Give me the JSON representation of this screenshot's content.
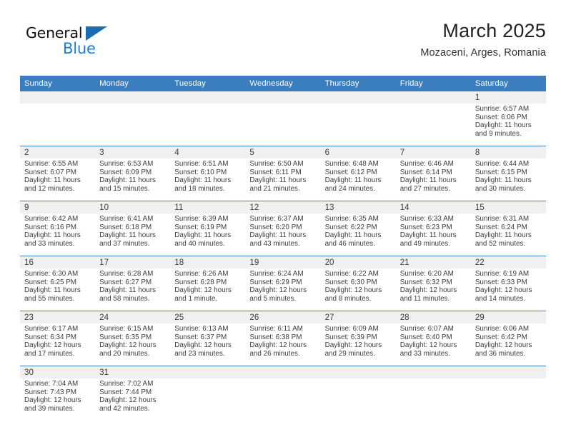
{
  "brand": {
    "name_part1": "General",
    "name_part2": "Blue",
    "triangle_icon": "blue-triangle-icon",
    "accent_color": "#1b7fd4",
    "header_color": "#3a7ebf"
  },
  "header": {
    "title": "March 2025",
    "subtitle": "Mozaceni, Arges, Romania"
  },
  "weekdays": [
    "Sunday",
    "Monday",
    "Tuesday",
    "Wednesday",
    "Thursday",
    "Friday",
    "Saturday"
  ],
  "weeks": [
    [
      {
        "day": "",
        "sunrise": "",
        "sunset": "",
        "daylight_line1": "",
        "daylight_line2": ""
      },
      {
        "day": "",
        "sunrise": "",
        "sunset": "",
        "daylight_line1": "",
        "daylight_line2": ""
      },
      {
        "day": "",
        "sunrise": "",
        "sunset": "",
        "daylight_line1": "",
        "daylight_line2": ""
      },
      {
        "day": "",
        "sunrise": "",
        "sunset": "",
        "daylight_line1": "",
        "daylight_line2": ""
      },
      {
        "day": "",
        "sunrise": "",
        "sunset": "",
        "daylight_line1": "",
        "daylight_line2": ""
      },
      {
        "day": "",
        "sunrise": "",
        "sunset": "",
        "daylight_line1": "",
        "daylight_line2": ""
      },
      {
        "day": "1",
        "sunrise": "Sunrise: 6:57 AM",
        "sunset": "Sunset: 6:06 PM",
        "daylight_line1": "Daylight: 11 hours",
        "daylight_line2": "and 9 minutes."
      }
    ],
    [
      {
        "day": "2",
        "sunrise": "Sunrise: 6:55 AM",
        "sunset": "Sunset: 6:07 PM",
        "daylight_line1": "Daylight: 11 hours",
        "daylight_line2": "and 12 minutes."
      },
      {
        "day": "3",
        "sunrise": "Sunrise: 6:53 AM",
        "sunset": "Sunset: 6:09 PM",
        "daylight_line1": "Daylight: 11 hours",
        "daylight_line2": "and 15 minutes."
      },
      {
        "day": "4",
        "sunrise": "Sunrise: 6:51 AM",
        "sunset": "Sunset: 6:10 PM",
        "daylight_line1": "Daylight: 11 hours",
        "daylight_line2": "and 18 minutes."
      },
      {
        "day": "5",
        "sunrise": "Sunrise: 6:50 AM",
        "sunset": "Sunset: 6:11 PM",
        "daylight_line1": "Daylight: 11 hours",
        "daylight_line2": "and 21 minutes."
      },
      {
        "day": "6",
        "sunrise": "Sunrise: 6:48 AM",
        "sunset": "Sunset: 6:12 PM",
        "daylight_line1": "Daylight: 11 hours",
        "daylight_line2": "and 24 minutes."
      },
      {
        "day": "7",
        "sunrise": "Sunrise: 6:46 AM",
        "sunset": "Sunset: 6:14 PM",
        "daylight_line1": "Daylight: 11 hours",
        "daylight_line2": "and 27 minutes."
      },
      {
        "day": "8",
        "sunrise": "Sunrise: 6:44 AM",
        "sunset": "Sunset: 6:15 PM",
        "daylight_line1": "Daylight: 11 hours",
        "daylight_line2": "and 30 minutes."
      }
    ],
    [
      {
        "day": "9",
        "sunrise": "Sunrise: 6:42 AM",
        "sunset": "Sunset: 6:16 PM",
        "daylight_line1": "Daylight: 11 hours",
        "daylight_line2": "and 33 minutes."
      },
      {
        "day": "10",
        "sunrise": "Sunrise: 6:41 AM",
        "sunset": "Sunset: 6:18 PM",
        "daylight_line1": "Daylight: 11 hours",
        "daylight_line2": "and 37 minutes."
      },
      {
        "day": "11",
        "sunrise": "Sunrise: 6:39 AM",
        "sunset": "Sunset: 6:19 PM",
        "daylight_line1": "Daylight: 11 hours",
        "daylight_line2": "and 40 minutes."
      },
      {
        "day": "12",
        "sunrise": "Sunrise: 6:37 AM",
        "sunset": "Sunset: 6:20 PM",
        "daylight_line1": "Daylight: 11 hours",
        "daylight_line2": "and 43 minutes."
      },
      {
        "day": "13",
        "sunrise": "Sunrise: 6:35 AM",
        "sunset": "Sunset: 6:22 PM",
        "daylight_line1": "Daylight: 11 hours",
        "daylight_line2": "and 46 minutes."
      },
      {
        "day": "14",
        "sunrise": "Sunrise: 6:33 AM",
        "sunset": "Sunset: 6:23 PM",
        "daylight_line1": "Daylight: 11 hours",
        "daylight_line2": "and 49 minutes."
      },
      {
        "day": "15",
        "sunrise": "Sunrise: 6:31 AM",
        "sunset": "Sunset: 6:24 PM",
        "daylight_line1": "Daylight: 11 hours",
        "daylight_line2": "and 52 minutes."
      }
    ],
    [
      {
        "day": "16",
        "sunrise": "Sunrise: 6:30 AM",
        "sunset": "Sunset: 6:25 PM",
        "daylight_line1": "Daylight: 11 hours",
        "daylight_line2": "and 55 minutes."
      },
      {
        "day": "17",
        "sunrise": "Sunrise: 6:28 AM",
        "sunset": "Sunset: 6:27 PM",
        "daylight_line1": "Daylight: 11 hours",
        "daylight_line2": "and 58 minutes."
      },
      {
        "day": "18",
        "sunrise": "Sunrise: 6:26 AM",
        "sunset": "Sunset: 6:28 PM",
        "daylight_line1": "Daylight: 12 hours",
        "daylight_line2": "and 1 minute."
      },
      {
        "day": "19",
        "sunrise": "Sunrise: 6:24 AM",
        "sunset": "Sunset: 6:29 PM",
        "daylight_line1": "Daylight: 12 hours",
        "daylight_line2": "and 5 minutes."
      },
      {
        "day": "20",
        "sunrise": "Sunrise: 6:22 AM",
        "sunset": "Sunset: 6:30 PM",
        "daylight_line1": "Daylight: 12 hours",
        "daylight_line2": "and 8 minutes."
      },
      {
        "day": "21",
        "sunrise": "Sunrise: 6:20 AM",
        "sunset": "Sunset: 6:32 PM",
        "daylight_line1": "Daylight: 12 hours",
        "daylight_line2": "and 11 minutes."
      },
      {
        "day": "22",
        "sunrise": "Sunrise: 6:19 AM",
        "sunset": "Sunset: 6:33 PM",
        "daylight_line1": "Daylight: 12 hours",
        "daylight_line2": "and 14 minutes."
      }
    ],
    [
      {
        "day": "23",
        "sunrise": "Sunrise: 6:17 AM",
        "sunset": "Sunset: 6:34 PM",
        "daylight_line1": "Daylight: 12 hours",
        "daylight_line2": "and 17 minutes."
      },
      {
        "day": "24",
        "sunrise": "Sunrise: 6:15 AM",
        "sunset": "Sunset: 6:35 PM",
        "daylight_line1": "Daylight: 12 hours",
        "daylight_line2": "and 20 minutes."
      },
      {
        "day": "25",
        "sunrise": "Sunrise: 6:13 AM",
        "sunset": "Sunset: 6:37 PM",
        "daylight_line1": "Daylight: 12 hours",
        "daylight_line2": "and 23 minutes."
      },
      {
        "day": "26",
        "sunrise": "Sunrise: 6:11 AM",
        "sunset": "Sunset: 6:38 PM",
        "daylight_line1": "Daylight: 12 hours",
        "daylight_line2": "and 26 minutes."
      },
      {
        "day": "27",
        "sunrise": "Sunrise: 6:09 AM",
        "sunset": "Sunset: 6:39 PM",
        "daylight_line1": "Daylight: 12 hours",
        "daylight_line2": "and 29 minutes."
      },
      {
        "day": "28",
        "sunrise": "Sunrise: 6:07 AM",
        "sunset": "Sunset: 6:40 PM",
        "daylight_line1": "Daylight: 12 hours",
        "daylight_line2": "and 33 minutes."
      },
      {
        "day": "29",
        "sunrise": "Sunrise: 6:06 AM",
        "sunset": "Sunset: 6:42 PM",
        "daylight_line1": "Daylight: 12 hours",
        "daylight_line2": "and 36 minutes."
      }
    ],
    [
      {
        "day": "30",
        "sunrise": "Sunrise: 7:04 AM",
        "sunset": "Sunset: 7:43 PM",
        "daylight_line1": "Daylight: 12 hours",
        "daylight_line2": "and 39 minutes."
      },
      {
        "day": "31",
        "sunrise": "Sunrise: 7:02 AM",
        "sunset": "Sunset: 7:44 PM",
        "daylight_line1": "Daylight: 12 hours",
        "daylight_line2": "and 42 minutes."
      },
      {
        "day": "",
        "sunrise": "",
        "sunset": "",
        "daylight_line1": "",
        "daylight_line2": ""
      },
      {
        "day": "",
        "sunrise": "",
        "sunset": "",
        "daylight_line1": "",
        "daylight_line2": ""
      },
      {
        "day": "",
        "sunrise": "",
        "sunset": "",
        "daylight_line1": "",
        "daylight_line2": ""
      },
      {
        "day": "",
        "sunrise": "",
        "sunset": "",
        "daylight_line1": "",
        "daylight_line2": ""
      },
      {
        "day": "",
        "sunrise": "",
        "sunset": "",
        "daylight_line1": "",
        "daylight_line2": ""
      }
    ]
  ]
}
